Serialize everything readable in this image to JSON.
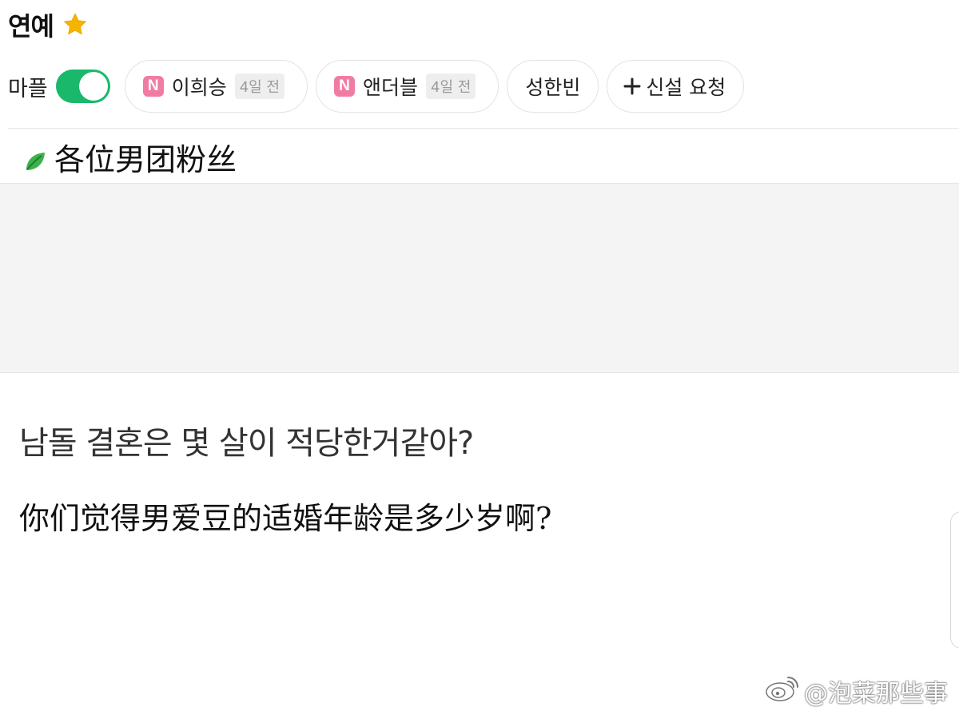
{
  "header": {
    "title": "연예",
    "favorite_icon": "star-icon",
    "favorite_color": "#f5b400"
  },
  "mafe": {
    "label": "마플",
    "toggle_on": true,
    "toggle_color": "#19b86b"
  },
  "chips": [
    {
      "label": "이희승",
      "badge": "N",
      "time": "4일 전"
    },
    {
      "label": "앤더블",
      "badge": "N",
      "time": "4일 전"
    },
    {
      "label": "성한빈"
    },
    {
      "label": "신설 요청",
      "icon": "plus-icon"
    }
  ],
  "subtitle": {
    "icon": "leaf-icon",
    "text": "各位男团粉丝"
  },
  "post": {
    "title": "남돌 결혼은 몇 살이 적당한거같아?",
    "translation": "你们觉得男爱豆的适婚年龄是多少岁啊?"
  },
  "watermark": {
    "logo": "weibo-logo",
    "text": "@泡菜那些事"
  }
}
